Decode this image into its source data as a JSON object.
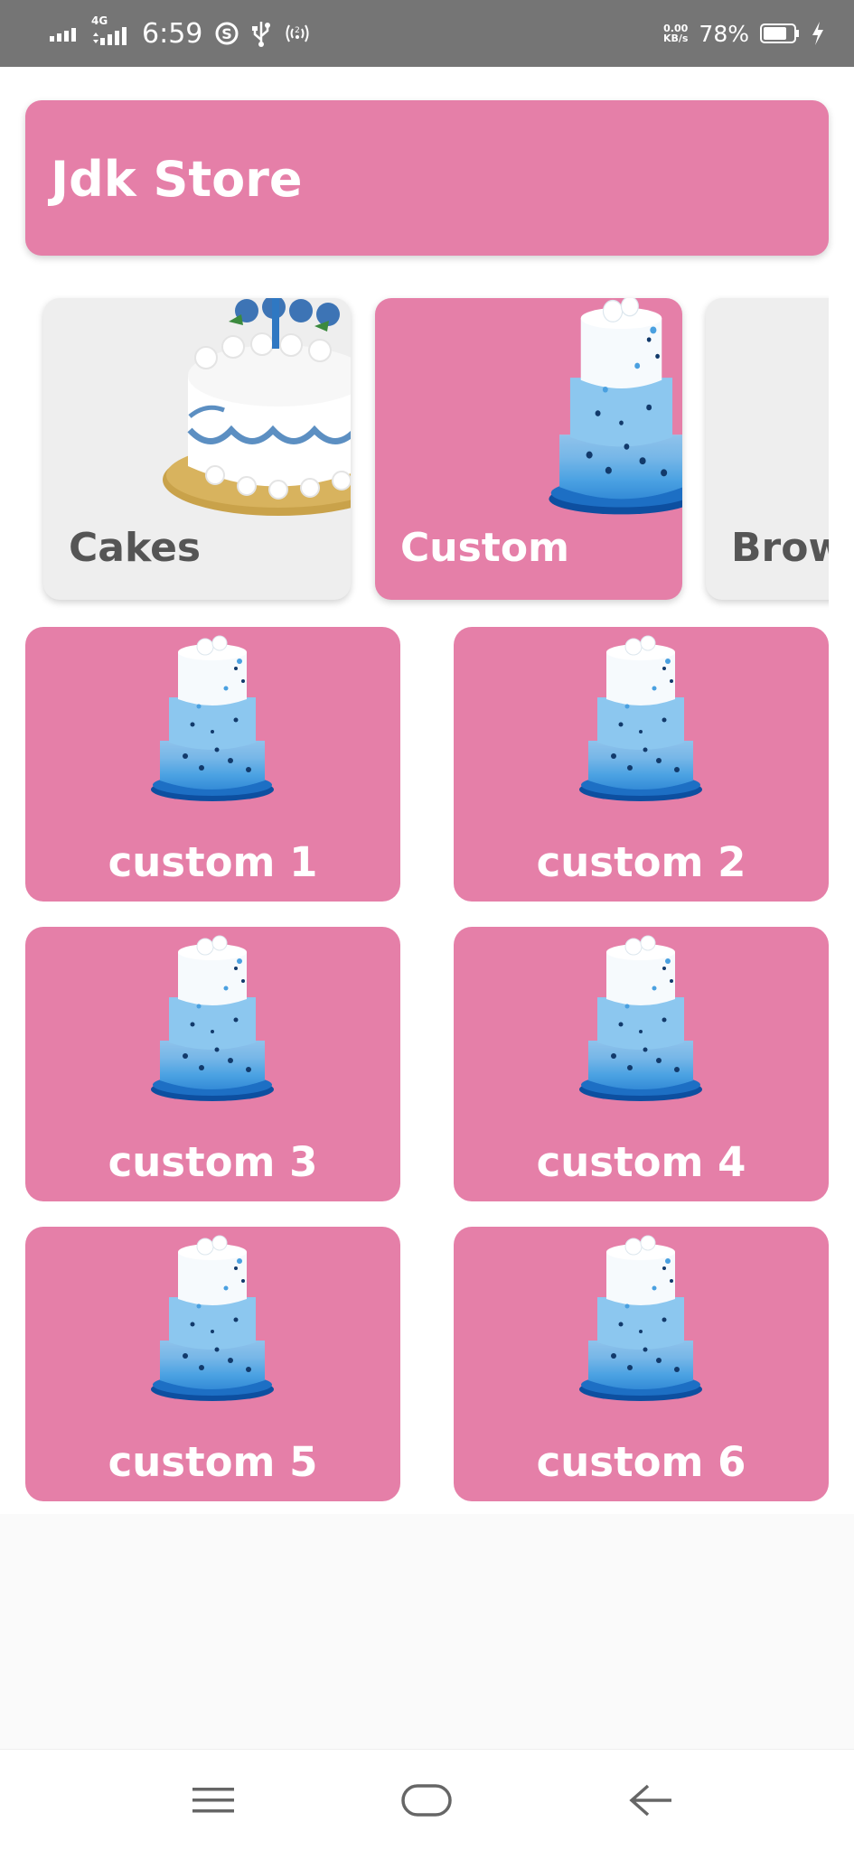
{
  "status_bar": {
    "network_type": "4G",
    "time": "6:59",
    "speed_value": "0.00",
    "speed_unit": "KB/s",
    "battery_percent": "78%",
    "battery_level": 0.78,
    "icons": [
      "signal-icon",
      "signal-4g-icon",
      "skype-icon",
      "usb-icon",
      "hotspot-icon",
      "battery-icon",
      "charging-icon"
    ]
  },
  "header": {
    "title": "Jdk Store",
    "background_color": "#e57fa8"
  },
  "categories": [
    {
      "label": "Cakes",
      "selected": false
    },
    {
      "label": "Custom",
      "selected": true
    },
    {
      "label": "Brow",
      "selected": false
    }
  ],
  "products": [
    {
      "label": "custom 1"
    },
    {
      "label": "custom 2"
    },
    {
      "label": "custom 3"
    },
    {
      "label": "custom 4"
    },
    {
      "label": "custom 5"
    },
    {
      "label": "custom 6"
    }
  ],
  "nav_bar": {
    "icons": [
      "menu-icon",
      "home-icon",
      "back-icon"
    ]
  },
  "colors": {
    "accent": "#e57fa8",
    "card_grey": "#eeeeee",
    "status_bar": "#757575"
  }
}
